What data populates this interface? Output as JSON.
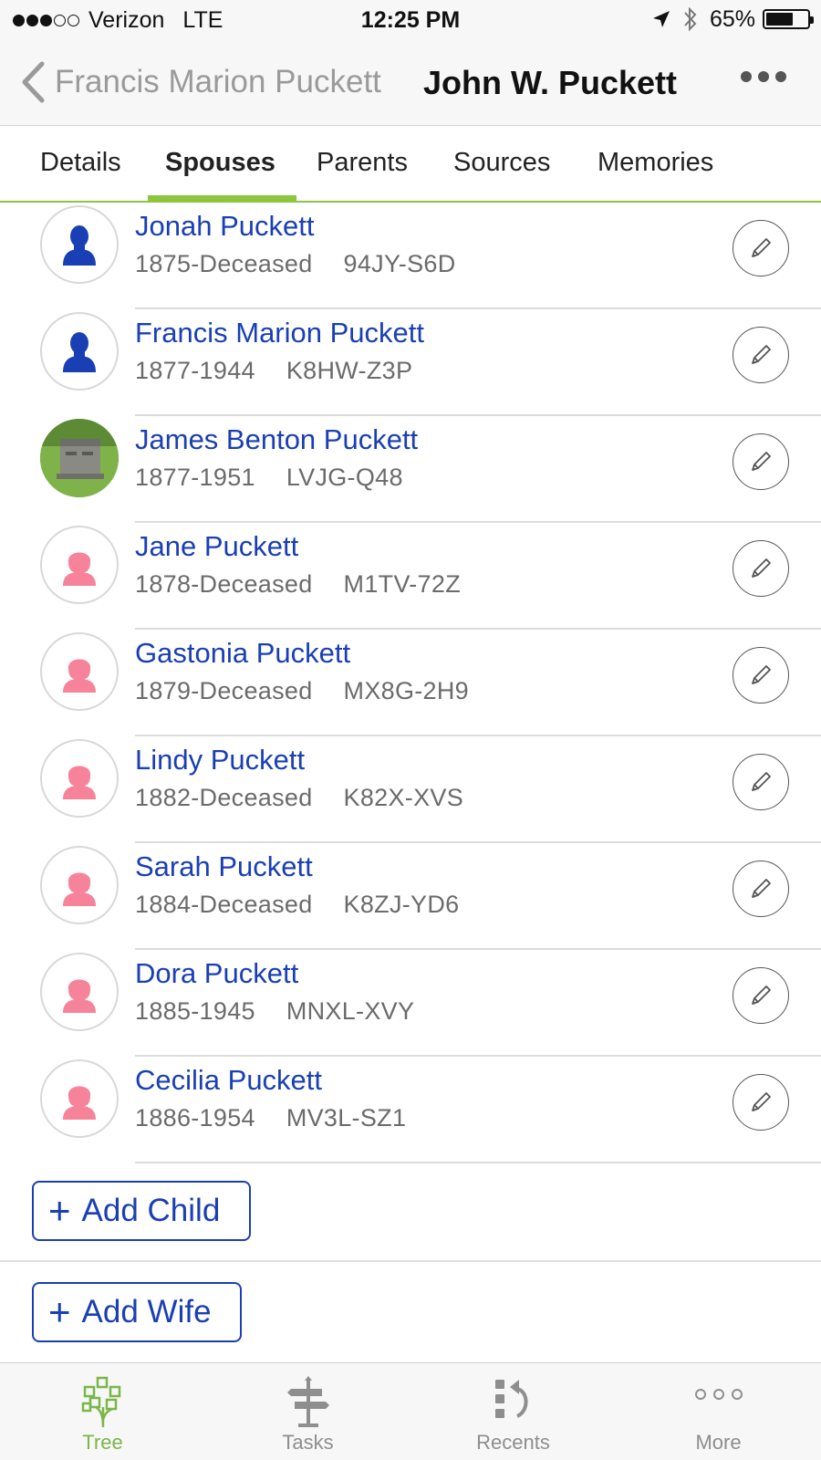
{
  "status_bar": {
    "carrier": "Verizon",
    "network": "LTE",
    "time": "12:25 PM",
    "battery": "65%",
    "battery_level": 0.65,
    "signal_bars_filled": 3,
    "signal_bars_total": 5
  },
  "nav": {
    "back_label": "Francis Marion Puckett",
    "title": "John W. Puckett"
  },
  "tabs": [
    {
      "label": "Details"
    },
    {
      "label": "Spouses",
      "active": true
    },
    {
      "label": "Parents"
    },
    {
      "label": "Sources"
    },
    {
      "label": "Memories"
    }
  ],
  "children": [
    {
      "name": "Jonah Puckett",
      "dates": "1875-Deceased",
      "pid": "94JY-S6D",
      "avatar": "male-silhouette-icon"
    },
    {
      "name": "Francis Marion Puckett",
      "dates": "1877-1944",
      "pid": "K8HW-Z3P",
      "avatar": "male-silhouette-icon"
    },
    {
      "name": "James Benton Puckett",
      "dates": "1877-1951",
      "pid": "LVJG-Q48",
      "avatar": "gravestone-photo"
    },
    {
      "name": "Jane Puckett",
      "dates": "1878-Deceased",
      "pid": "M1TV-72Z",
      "avatar": "female-silhouette-icon"
    },
    {
      "name": "Gastonia Puckett",
      "dates": "1879-Deceased",
      "pid": "MX8G-2H9",
      "avatar": "female-silhouette-icon"
    },
    {
      "name": "Lindy Puckett",
      "dates": "1882-Deceased",
      "pid": "K82X-XVS",
      "avatar": "female-silhouette-icon"
    },
    {
      "name": "Sarah Puckett",
      "dates": "1884-Deceased",
      "pid": "K8ZJ-YD6",
      "avatar": "female-silhouette-icon"
    },
    {
      "name": "Dora Puckett",
      "dates": "1885-1945",
      "pid": "MNXL-XVY",
      "avatar": "female-silhouette-icon"
    },
    {
      "name": "Cecilia Puckett",
      "dates": "1886-1954",
      "pid": "MV3L-SZ1",
      "avatar": "female-silhouette-icon"
    }
  ],
  "actions": {
    "add_child": "Add Child",
    "add_wife": "Add Wife",
    "plus": "+"
  },
  "tab_bar": [
    {
      "label": "Tree",
      "icon": "tree-icon",
      "active": true
    },
    {
      "label": "Tasks",
      "icon": "signpost-icon"
    },
    {
      "label": "Recents",
      "icon": "recents-icon"
    },
    {
      "label": "More",
      "icon": "more-dots-icon"
    }
  ],
  "colors": {
    "link_blue": "#1a3fb5",
    "accent_green": "#8cc63f",
    "male_blue": "#1a3fb5",
    "female_pink": "#f7839a"
  }
}
